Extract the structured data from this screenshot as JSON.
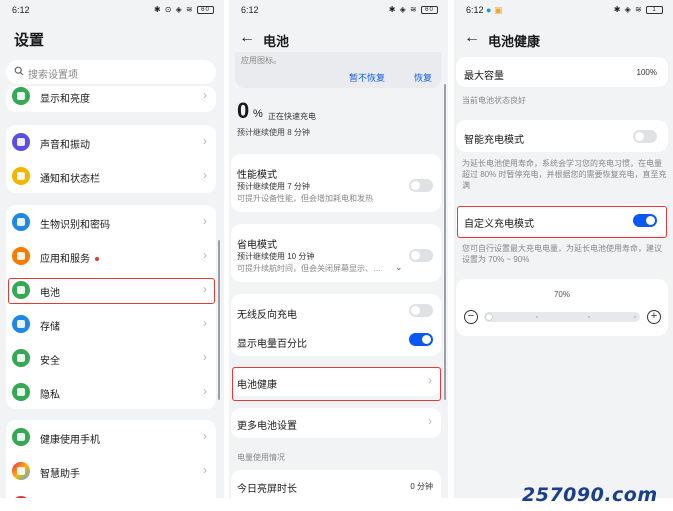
{
  "colors": {
    "accent": "#0a59f7",
    "highlight": "#e53935",
    "background": "#f1f3f5"
  },
  "settings": {
    "time": "6:12",
    "status_icons": "✱ ⊙ ◈ ≋",
    "battery": "60",
    "title": "设置",
    "search_placeholder": "搜索设置项",
    "items": [
      {
        "label": "显示和亮度",
        "icon": "sun-icon",
        "color": "#34a853"
      },
      {
        "label": "声音和振动",
        "icon": "speaker-icon",
        "color": "#5b4ee5"
      },
      {
        "label": "通知和状态栏",
        "icon": "bell-icon",
        "color": "#f4b400"
      },
      {
        "label": "生物识别和密码",
        "icon": "key-icon",
        "color": "#1e88e5"
      },
      {
        "label": "应用和服务",
        "icon": "apps-icon",
        "color": "#f57c00"
      },
      {
        "label": "电池",
        "icon": "battery-icon",
        "color": "#34a853"
      },
      {
        "label": "存储",
        "icon": "storage-icon",
        "color": "#1e88e5"
      },
      {
        "label": "安全",
        "icon": "shield-icon",
        "color": "#34a853"
      },
      {
        "label": "隐私",
        "icon": "lock-icon",
        "color": "#34a853"
      },
      {
        "label": "健康使用手机",
        "icon": "hourglass-icon",
        "color": "#34a853"
      },
      {
        "label": "智慧助手",
        "icon": "assistant-icon",
        "color": "#e91e63"
      }
    ]
  },
  "battery": {
    "time": "6:12",
    "status_icons": "✱ ◈ ≋",
    "battery": "60",
    "title": "电池",
    "banner_text": "应用图标。",
    "banner_dismiss": "暂不恢复",
    "banner_restore": "恢复",
    "percent": "0",
    "percent_unit": "%",
    "charging_status": "正在快速充电",
    "estimate": "预计继续使用 8 分钟",
    "performance_mode": {
      "title": "性能模式",
      "estimate": "预计继续使用 7 分钟",
      "hint": "可提升设备性能，但会增加耗电和发热"
    },
    "power_saving_mode": {
      "title": "省电模式",
      "estimate": "预计继续使用 10 分钟",
      "hint": "可提升续航时间，但会关闭屏幕显示、…"
    },
    "wireless_reverse": "无线反向充电",
    "show_percentage": "显示电量百分比",
    "battery_health": "电池健康",
    "more_settings": "更多电池设置",
    "usage_section": "电量使用情况",
    "screen_time_label": "今日亮屏时长",
    "screen_time_value": "0 分钟"
  },
  "health": {
    "time": "6:12",
    "status_icons": "✱ ◈ ≋",
    "battery": "1",
    "title": "电池健康",
    "max_capacity_label": "最大容量",
    "max_capacity_value": "100%",
    "capacity_status": "当前电池状态良好",
    "smart_charging": "智能充电模式",
    "smart_charging_hint": "为延长电池使用寿命，系统会学习您的充电习惯，在电量超过 80% 时暂停充电，并根据您的需要恢复充电，直至充满",
    "custom_charging": "自定义充电模式",
    "custom_charging_hint": "您可自行设置最大充电电量，为延长电池使用寿命，建议设置为 70% ~ 90%",
    "slider_value_label": "70%",
    "slider_level_percent": 0,
    "minus": "−",
    "plus": "+"
  },
  "watermark": "257090.com"
}
